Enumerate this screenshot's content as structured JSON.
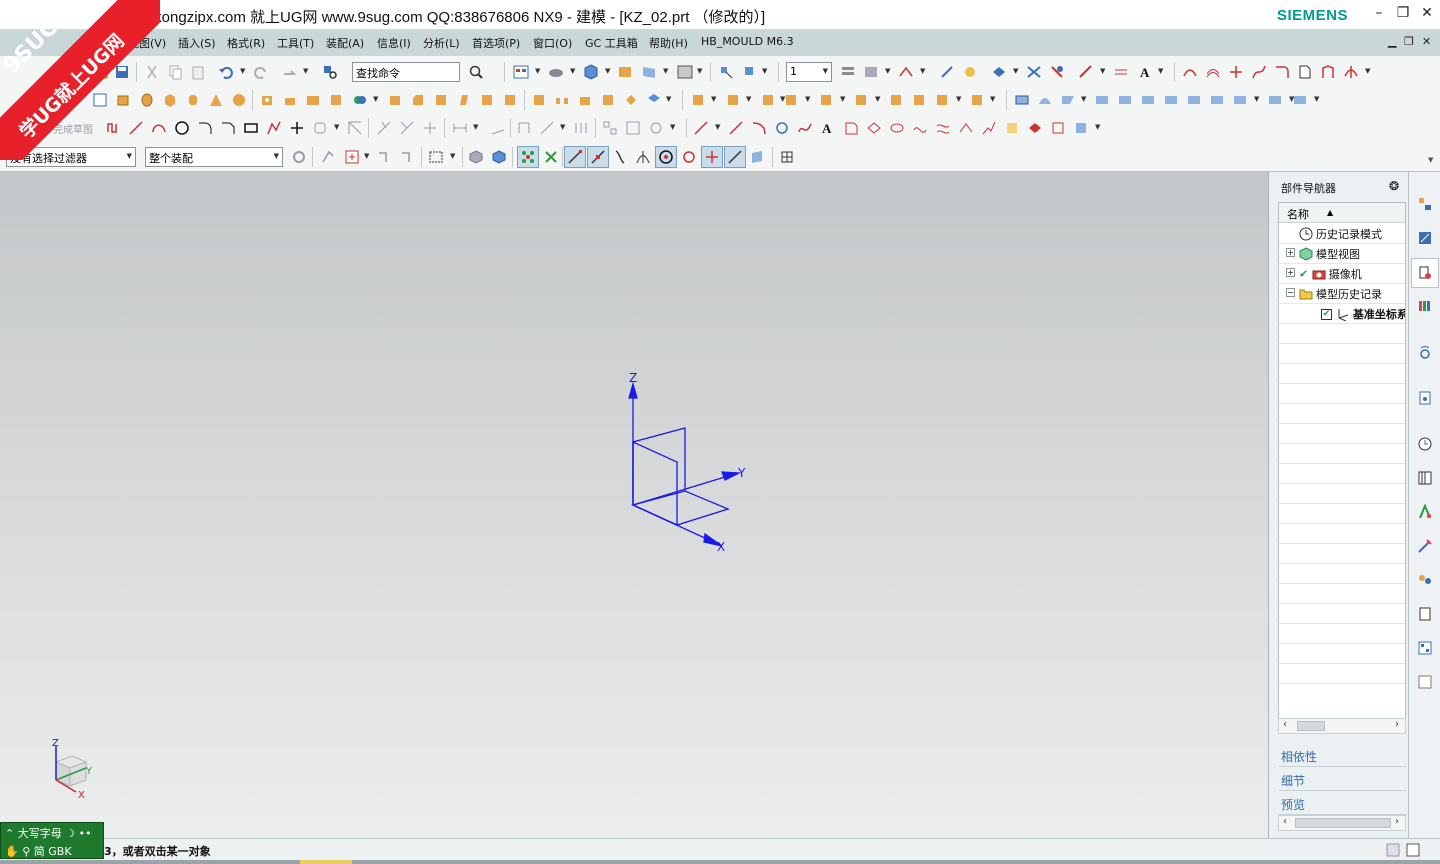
{
  "window": {
    "title": "w.kongzipx.com 就上UG网 www.9sug.com QQ:838676806 NX9 - 建模 - [KZ_02.prt （修改的）]",
    "brand": "SIEMENS"
  },
  "watermark": {
    "line1": "9SUG",
    "line2": "学UG就上UG网"
  },
  "menu": {
    "items": [
      "视图(V)",
      "插入(S)",
      "格式(R)",
      "工具(T)",
      "装配(A)",
      "信息(I)",
      "分析(L)",
      "首选项(P)",
      "窗口(O)",
      "GC 工具箱",
      "帮助(H)",
      "HB_MOULD M6.3"
    ]
  },
  "toolbar": {
    "search_placeholder": "查找命令",
    "layer_value": "1",
    "sketch_finish_label": "完成草图",
    "selection_filter": "没有选择过滤器",
    "assembly_scope": "整个装配"
  },
  "viewport": {
    "axis_labels": {
      "x": "X",
      "y": "Y",
      "z": "Z"
    }
  },
  "navigator": {
    "title": "部件导航器",
    "column_header": "名称",
    "nodes": [
      {
        "label": "历史记录模式",
        "icon": "clock-icon"
      },
      {
        "label": "模型视图",
        "icon": "model-views-icon"
      },
      {
        "label": "摄像机",
        "icon": "camera-icon"
      },
      {
        "label": "模型历史记录",
        "icon": "folder-open-icon"
      },
      {
        "label": "基准坐标系",
        "icon": "datum-csys-icon"
      }
    ],
    "sections": [
      "相依性",
      "细节",
      "预览"
    ]
  },
  "ime": {
    "row1": "大写字母",
    "row2": "简 GBK"
  },
  "status": {
    "message": "3，或者双击某一对象"
  },
  "colors": {
    "brand": "#009999",
    "menubar": "#c9d7d8",
    "axes": "#1a1ae6",
    "watermark": "#e8202a"
  }
}
